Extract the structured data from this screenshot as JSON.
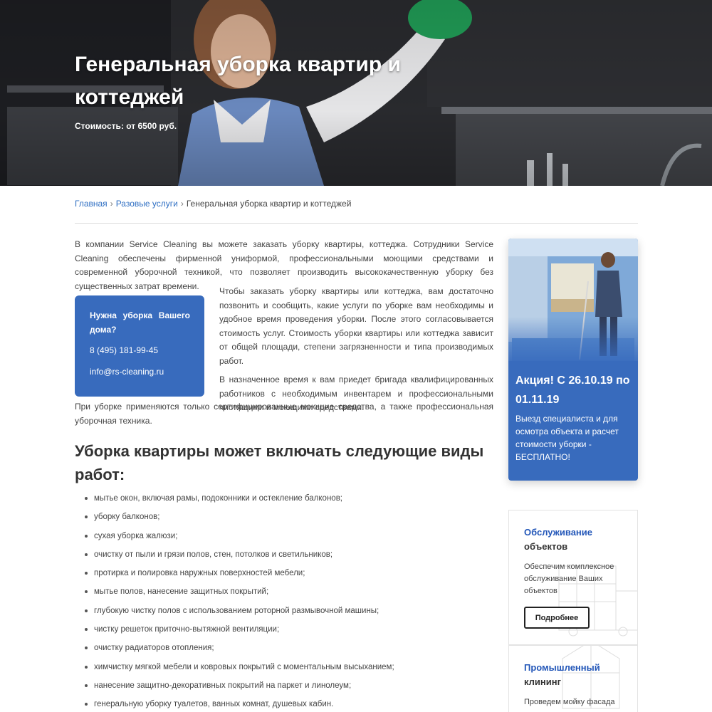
{
  "hero": {
    "title": "Генеральная уборка квартир и коттеджей",
    "price": "Стоимость: от 6500 руб."
  },
  "breadcrumb": {
    "home": "Главная",
    "separator": "›",
    "section": "Разовые услуги",
    "current": "Генеральная уборка квартир и коттеджей"
  },
  "main": {
    "intro": "В компании Service Cleaning вы можете заказать уборку квартиры, коттеджа. Сотрудники Service Cleaning обеспечены фирменной униформой, профессиональными моющими средствами и современной уборочной техникой, что позволяет производить высококачественную уборку без существенных затрат времени.",
    "paragraph_order": "Чтобы заказать уборку квартиры или коттеджа, вам достаточно позвонить и сообщить, какие услуги по уборке вам необходимы и удобное время проведения уборки. После этого согласовывается стоимость услуг. Стоимость уборки квартиры или коттеджа зависит от общей площади, степени загрязненности и типа производимых работ.",
    "paragraph_team": "В назначенное время к вам приедет бригада квалифицированных работников с необходимым инвентарем и профессиональными чистящими и моющими средствами.",
    "paragraph_certified": "При уборке применяются только сертифицированные моющие средства, а также профессиональная уборочная техника.",
    "services_heading": "Уборка квартиры может включать следующие виды работ:",
    "services": [
      "мытье окон, включая рамы, подоконники и остекление балконов;",
      "уборку балконов;",
      "сухая уборка жалюзи;",
      "очистку от пыли и грязи полов, стен, потолков и светильников;",
      "протирка и полировка наружных поверхностей мебели;",
      "мытье полов, нанесение защитных покрытий;",
      "глубокую чистку полов с использованием роторной размывочной машины;",
      "чистку решеток приточно-вытяжной вентиляции;",
      "очистку радиаторов отопления;",
      "химчистку мягкой мебели и ковровых покрытий с моментальным высыханием;",
      "нанесение защитно-декоративных покрытий на паркет и линолеум;",
      "генеральную уборку туалетов, ванных комнат, душевых кабин."
    ]
  },
  "contact": {
    "title": "Нужна уборка Вашего дома?",
    "phone": "8 (495) 181-99-45",
    "email": "info@rs-cleaning.ru"
  },
  "promo": {
    "title": "Акция! С 26.10.19 по 01.11.19",
    "text": "Выезд специалиста и для осмотра объекта и расчет стоимости уборки - БЕСПЛАТНО!"
  },
  "cards": [
    {
      "title_accent": "Обслуживание",
      "title_rest": "объектов",
      "description": "Обеспечим комплексное обслуживание Ваших объектов",
      "button": "Подробнее"
    },
    {
      "title_accent": "Промышленный",
      "title_rest": "клининг",
      "description": "Проведем мойку фасада"
    }
  ],
  "colors": {
    "accent_blue": "#386bbd",
    "link_blue": "#2f6fc3",
    "card_title_blue": "#2256b8"
  }
}
